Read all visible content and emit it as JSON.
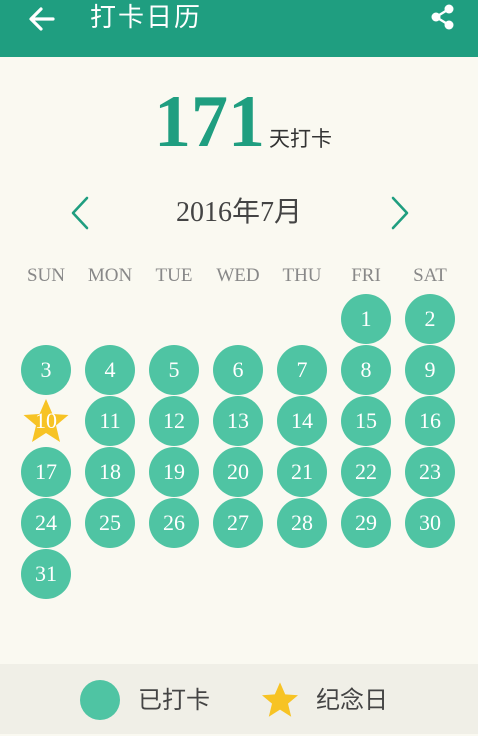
{
  "header": {
    "title": "打卡日历",
    "back_icon": "arrow-left-icon",
    "share_icon": "share-icon",
    "background": "#1f9e80"
  },
  "counter": {
    "value": "171",
    "unit": "天打卡",
    "color": "#1f9e80"
  },
  "month": {
    "label": "2016年7月",
    "prev_icon": "chevron-left-icon",
    "next_icon": "chevron-right-icon"
  },
  "weekdays": [
    "SUN",
    "MON",
    "TUE",
    "WED",
    "THU",
    "FRI",
    "SAT"
  ],
  "calendar": {
    "first_weekday_index": 5,
    "checked_color": "#4fc4a3",
    "memorial_color": "#f7c324",
    "days": [
      {
        "day": "1",
        "status": "checked"
      },
      {
        "day": "2",
        "status": "checked"
      },
      {
        "day": "3",
        "status": "checked"
      },
      {
        "day": "4",
        "status": "checked"
      },
      {
        "day": "5",
        "status": "checked"
      },
      {
        "day": "6",
        "status": "checked"
      },
      {
        "day": "7",
        "status": "checked"
      },
      {
        "day": "8",
        "status": "checked"
      },
      {
        "day": "9",
        "status": "checked"
      },
      {
        "day": "10",
        "status": "memorial"
      },
      {
        "day": "11",
        "status": "checked"
      },
      {
        "day": "12",
        "status": "checked"
      },
      {
        "day": "13",
        "status": "checked"
      },
      {
        "day": "14",
        "status": "checked"
      },
      {
        "day": "15",
        "status": "checked"
      },
      {
        "day": "16",
        "status": "checked"
      },
      {
        "day": "17",
        "status": "checked"
      },
      {
        "day": "18",
        "status": "checked"
      },
      {
        "day": "19",
        "status": "checked"
      },
      {
        "day": "20",
        "status": "checked"
      },
      {
        "day": "21",
        "status": "checked"
      },
      {
        "day": "22",
        "status": "checked"
      },
      {
        "day": "23",
        "status": "checked"
      },
      {
        "day": "24",
        "status": "checked"
      },
      {
        "day": "25",
        "status": "checked"
      },
      {
        "day": "26",
        "status": "checked"
      },
      {
        "day": "27",
        "status": "checked"
      },
      {
        "day": "28",
        "status": "checked"
      },
      {
        "day": "29",
        "status": "checked"
      },
      {
        "day": "30",
        "status": "checked"
      },
      {
        "day": "31",
        "status": "checked"
      }
    ]
  },
  "legend": {
    "checked_label": "已打卡",
    "memorial_label": "纪念日",
    "checked_icon": "circle-icon",
    "memorial_icon": "star-icon"
  }
}
